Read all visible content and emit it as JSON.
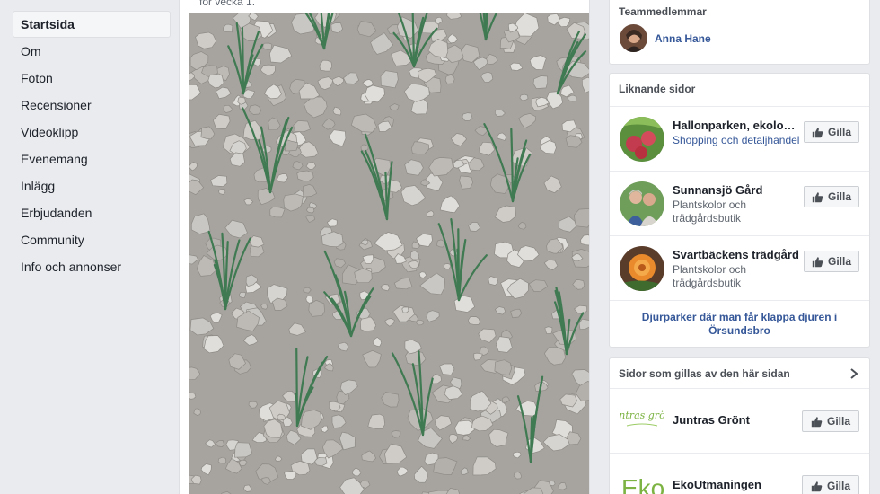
{
  "nav": {
    "items": [
      {
        "label": "Startsida",
        "active": true
      },
      {
        "label": "Om"
      },
      {
        "label": "Foton"
      },
      {
        "label": "Recensioner"
      },
      {
        "label": "Videoklipp"
      },
      {
        "label": "Evenemang"
      },
      {
        "label": "Inlägg"
      },
      {
        "label": "Erbjudanden"
      },
      {
        "label": "Community"
      },
      {
        "label": "Info och annonser"
      }
    ]
  },
  "post": {
    "caption": "för vecka 1.",
    "photo_description_icon": "gravel-with-grass-photo"
  },
  "team": {
    "heading": "Teammedlemmar",
    "members": [
      {
        "name": "Anna Hane"
      }
    ]
  },
  "similar": {
    "heading": "Liknande sidor",
    "pages": [
      {
        "name": "Hallonparken, ekologi...",
        "category": "Shopping och detaljhandel",
        "link_category": true,
        "like_label": "Gilla"
      },
      {
        "name": "Sunnansjö Gård",
        "category": "Plantskolor och trädgårdsbutik",
        "like_label": "Gilla"
      },
      {
        "name": "Svartbäckens trädgård",
        "category": "Plantskolor och trädgårdsbutik",
        "like_label": "Gilla"
      }
    ],
    "see_more": "Djurparker där man får klappa djuren i Örsundsbro"
  },
  "liked": {
    "heading": "Sidor som gillas av den här sidan",
    "pages": [
      {
        "name": "Juntras Grönt",
        "logo_text": "Juntras grönt",
        "like_label": "Gilla"
      },
      {
        "name": "EkoUtmaningen",
        "logo_text": "Eko",
        "like_label": "Gilla"
      }
    ]
  },
  "colors": {
    "background": "#e9ebee",
    "link": "#365899",
    "text": "#1d2129",
    "muted": "#616770",
    "logo_green": "#7cb342"
  }
}
